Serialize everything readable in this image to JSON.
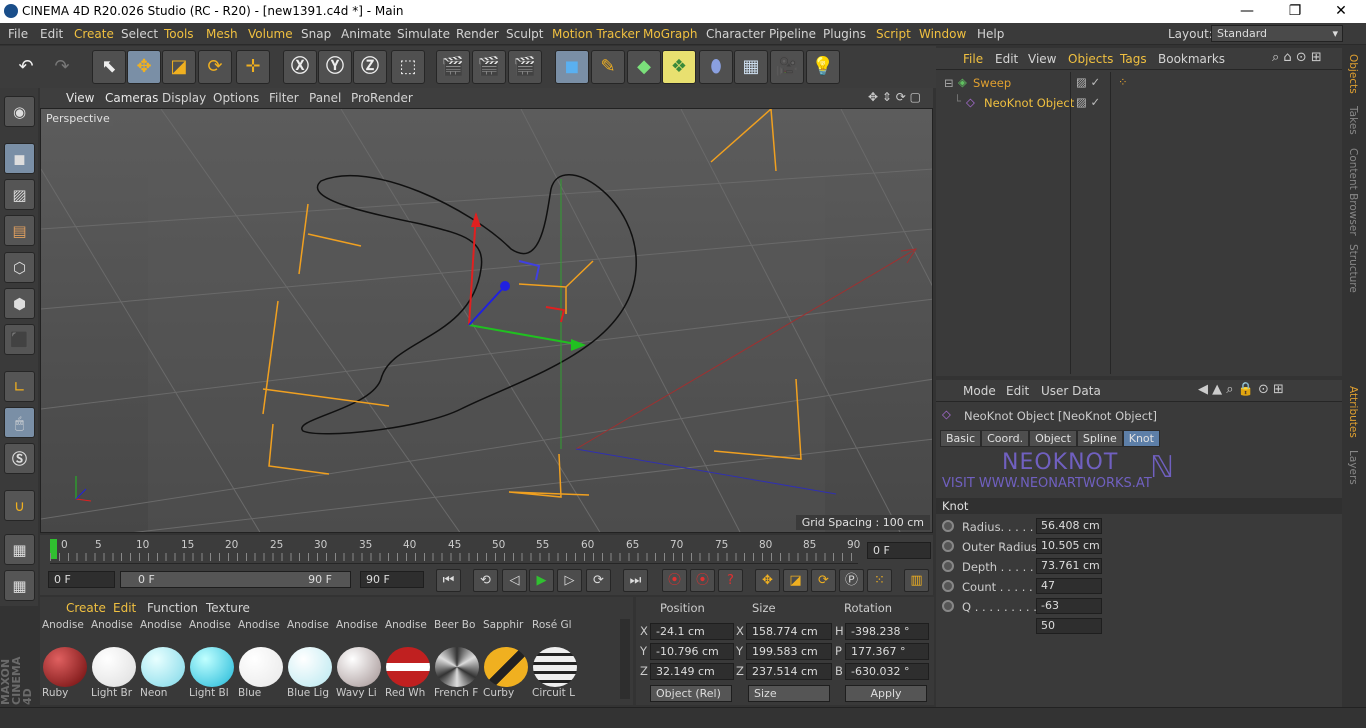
{
  "titlebar": {
    "title": "CINEMA 4D R20.026 Studio (RC - R20) - [new1391.c4d *] - Main",
    "minimize": "—",
    "maximize": "❐",
    "close": "✕"
  },
  "menu": {
    "items": [
      "File",
      "Edit",
      "Create",
      "Select",
      "Tools",
      "Mesh",
      "Volume",
      "Snap",
      "Animate",
      "Simulate",
      "Render",
      "Sculpt",
      "Motion Tracker",
      "MoGraph",
      "Character",
      "Pipeline",
      "Plugins",
      "Script",
      "Window",
      "Help"
    ],
    "layout_label": "Layout:",
    "layout_value": "Standard"
  },
  "viewport": {
    "menu": [
      "View",
      "Cameras",
      "Display",
      "Options",
      "Filter",
      "Panel",
      "ProRender"
    ],
    "label": "Perspective",
    "grid_spacing": "Grid Spacing : 100 cm"
  },
  "timeline": {
    "ticks": [
      "0",
      "5",
      "10",
      "15",
      "20",
      "25",
      "30",
      "35",
      "40",
      "45",
      "50",
      "55",
      "60",
      "65",
      "70",
      "75",
      "80",
      "85",
      "90"
    ],
    "current_frame": "0 F"
  },
  "transport": {
    "start": "0 F",
    "range_start": "0 F",
    "range_end": "90 F",
    "end": "90 F"
  },
  "materials": {
    "menu": [
      "Create",
      "Edit",
      "Function",
      "Texture"
    ],
    "row1": [
      "Anodise",
      "Anodise",
      "Anodise",
      "Anodise",
      "Anodise",
      "Anodise",
      "Anodise",
      "Anodise",
      "Beer Bo",
      "Sapphir",
      "Rosé Gl"
    ],
    "row2": [
      "Ruby",
      "Light Br",
      "Neon",
      "Light Bl",
      "Blue",
      "Blue Lig",
      "Wavy Li",
      "Red Wh",
      "French F",
      "Curby",
      "Circuit L"
    ]
  },
  "coordinates": {
    "headers": [
      "Position",
      "Size",
      "Rotation"
    ],
    "rows": [
      {
        "axis": "X",
        "pos": "-24.1 cm",
        "size_axis": "X",
        "size": "158.774 cm",
        "rot_axis": "H",
        "rot": "-398.238 °"
      },
      {
        "axis": "Y",
        "pos": "-10.796 cm",
        "size_axis": "Y",
        "size": "199.583 cm",
        "rot_axis": "P",
        "rot": "177.367 °"
      },
      {
        "axis": "Z",
        "pos": "32.149 cm",
        "size_axis": "Z",
        "size": "237.514 cm",
        "rot_axis": "B",
        "rot": "-630.032 °"
      }
    ],
    "mode": "Object (Rel)",
    "size_mode": "Size",
    "apply": "Apply"
  },
  "objects": {
    "menu": [
      "File",
      "Edit",
      "View",
      "Objects",
      "Tags",
      "Bookmarks"
    ],
    "items": [
      {
        "name": "Sweep",
        "color": "#e0a030"
      },
      {
        "name": "NeoKnot Object",
        "color": "#f0c040"
      }
    ]
  },
  "attributes": {
    "menu": [
      "Mode",
      "Edit",
      "User Data"
    ],
    "title": "NeoKnot Object [NeoKnot Object]",
    "tabs": [
      "Basic",
      "Coord.",
      "Object",
      "Spline",
      "Knot"
    ],
    "banner_title": "NEOKNOT",
    "banner_sub": "VISIT WWW.NEONARTWORKS.AT",
    "section": "Knot",
    "params": [
      {
        "label": "Radius. . . . . .",
        "value": "56.408 cm"
      },
      {
        "label": "Outer Radius",
        "value": "10.505 cm"
      },
      {
        "label": "Depth . . . . . .",
        "value": "73.761 cm"
      },
      {
        "label": "Count . . . . . .",
        "value": "47"
      },
      {
        "label": "Q . . . . . . . . . .",
        "value": "-63"
      },
      {
        "label": "",
        "value": "50"
      }
    ]
  },
  "sidetabs": [
    "Objects",
    "Takes",
    "Content Browser",
    "Structure",
    "Attributes",
    "Layers"
  ],
  "brand": "MAXON CINEMA 4D"
}
